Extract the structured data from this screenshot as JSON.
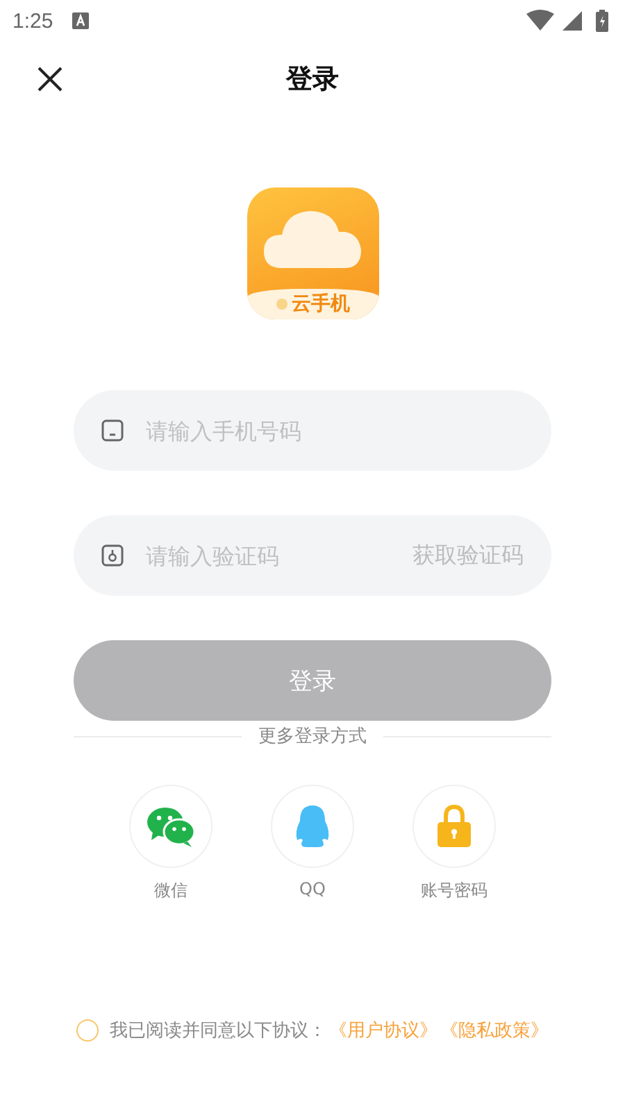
{
  "status_bar": {
    "time": "1:25"
  },
  "header": {
    "title": "登录"
  },
  "logo": {
    "caption": "云手机"
  },
  "phone_field": {
    "placeholder": "请输入手机号码"
  },
  "code_field": {
    "placeholder": "请输入验证码",
    "action": "获取验证码"
  },
  "login_button": {
    "label": "登录",
    "disabled": true
  },
  "more_methods": {
    "label": "更多登录方式"
  },
  "methods": [
    {
      "kind": "wechat",
      "label": "微信"
    },
    {
      "kind": "qq",
      "label": "QQ"
    },
    {
      "kind": "password",
      "label": "账号密码"
    }
  ],
  "agreement": {
    "checked": false,
    "text": "我已阅读并同意以下协议：",
    "links": [
      "《用户协议》",
      "《隐私政策》"
    ]
  }
}
